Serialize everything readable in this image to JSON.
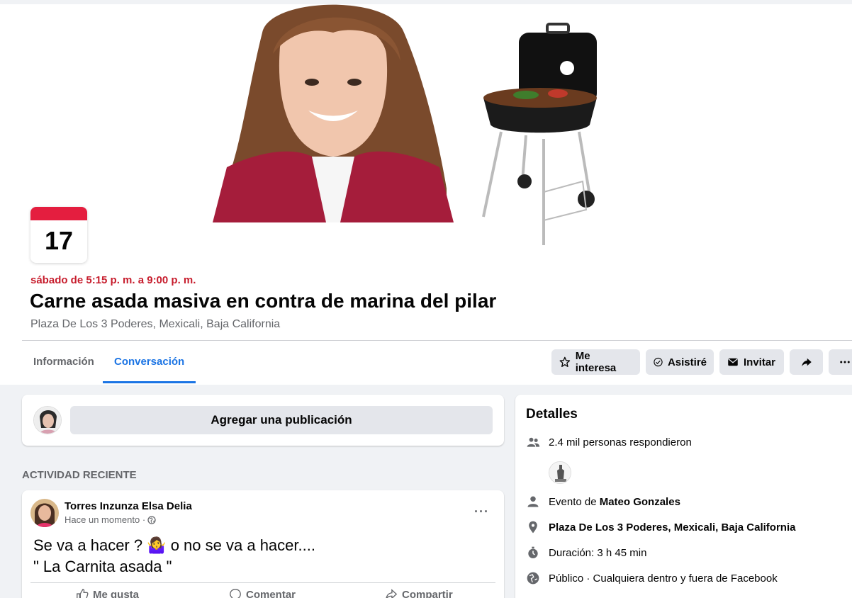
{
  "event": {
    "calendar_day": "17",
    "date_line": "sábado de 5:15 p. m. a 9:00 p. m.",
    "title": "Carne asada masiva en contra de marina del pilar",
    "location": "Plaza De Los 3 Poderes, Mexicali, Baja California"
  },
  "tabs": [
    {
      "label": "Información"
    },
    {
      "label": "Conversación"
    }
  ],
  "actions": {
    "interested": "Me interesa",
    "going": "Asistiré",
    "invite": "Invitar"
  },
  "composer": {
    "placeholder": "Agregar una publicación"
  },
  "recent_label": "ACTIVIDAD RECIENTE",
  "post": {
    "author": "Torres Inzunza Elsa Delia",
    "time": "Hace un momento ·",
    "text": "Se va a hacer ? 🤷‍♀️ o no se va a hacer....\n\" La Carnita asada \"",
    "like": "Me gusta",
    "comment": "Comentar",
    "share": "Compartir"
  },
  "details": {
    "heading": "Detalles",
    "responded": "2.4 mil personas respondieron",
    "event_by_prefix": "Evento de ",
    "event_by_name": "Mateo Gonzales",
    "place": "Plaza De Los 3 Poderes, Mexicali, Baja California",
    "duration": "Duración: 3 h 45 min",
    "privacy": "Público · Cualquiera dentro y fuera de Facebook"
  },
  "colors": {
    "accent": "#1b74e4",
    "date_red": "#c71d2d",
    "calendar_red": "#e41e3f"
  }
}
